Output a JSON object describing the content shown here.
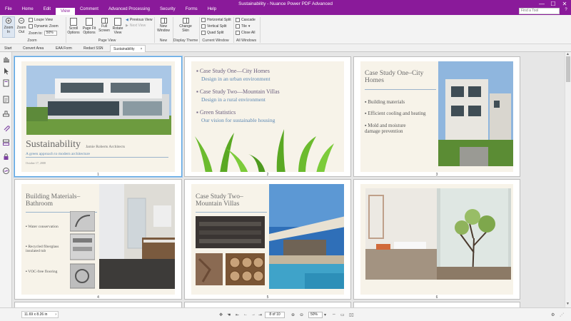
{
  "app": {
    "title": "Sustainability - Nuance Power PDF Advanced",
    "find_placeholder": "Find a Tool",
    "help": "?"
  },
  "menu": [
    "File",
    "Home",
    "Edit",
    "View",
    "Comment",
    "Advanced Processing",
    "Security",
    "Forms",
    "Help"
  ],
  "ribbon": {
    "zoom_in": "Zoom In",
    "zoom_out": "Zoom Out",
    "loupe_view": "Loupe View",
    "dynamic_zoom": "Dynamic Zoom",
    "zoom_to": "Zoom to:",
    "zoom_value": "50%",
    "zoom_group": "Zoom",
    "scroll_options": "Scroll Options",
    "page_fit_options": "Page Fit Options",
    "full_screen": "Full Screen",
    "rotate_view": "Rotate View",
    "previous_view": "Previous View",
    "next_view": "Next View",
    "page_view_group": "Page View",
    "new_window": "New Window",
    "new_group": "New",
    "change_skin": "Change Skin",
    "display_theme_group": "Display Theme",
    "horizontal_split": "Horizontal Split",
    "vertical_split": "Vertical Split",
    "quad_split": "Quad Split",
    "current_window_group": "Current Window",
    "cascade": "Cascade",
    "tile": "Tile",
    "close_all": "Close All",
    "all_windows_group": "All Windows"
  },
  "tabs": [
    "Start",
    "Convert Area",
    "EAA Form",
    "Redact SSN",
    "Sustainability"
  ],
  "tab_close": "×",
  "slides": {
    "s1": {
      "title": "Sustainability",
      "author": "Jamie Roberts Architects",
      "subtitle": "A green approach to modern architecture",
      "date": "October 17, 2008",
      "page": "1"
    },
    "s2": {
      "b1": "Case Study One—City Homes",
      "b1s": "Design in an urban environment",
      "b2": "Case Study Two—Mountain Villas",
      "b2s": "Design in a rural environment",
      "b3": "Green Statistics",
      "b3s": "Our vision for sustainable housing",
      "page": "2"
    },
    "s3": {
      "title": "Case Study One–City Homes",
      "b1": "Building materials",
      "b2": "Efficient cooling and heating",
      "b3": "Mold and moisture damage prevention",
      "page": "3"
    },
    "s4": {
      "title": "Building Materials–Bathroom",
      "b1": "Water conservation",
      "b2": "Recycled fiberglass insulated tub",
      "b3": "VOC-free flooring",
      "page": "4"
    },
    "s5": {
      "title": "Case Study Two–Mountain Villas",
      "page": "5"
    },
    "s6": {
      "page": "6"
    }
  },
  "status": {
    "page_size": "11.69 x 8.26 in",
    "page_indicator": "8 of 10",
    "zoom": "50%"
  },
  "colors": {
    "titlebar": "#8a1a9a",
    "slide_bg": "#f7f3e9",
    "selection": "#5aa3e0"
  }
}
